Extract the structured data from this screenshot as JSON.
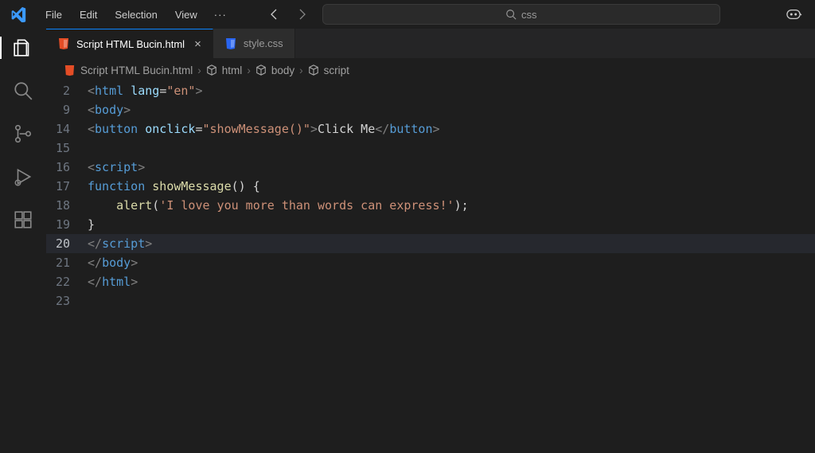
{
  "menu": {
    "file": "File",
    "edit": "Edit",
    "selection": "Selection",
    "view": "View",
    "more": "···"
  },
  "search": {
    "placeholder": "css"
  },
  "tabs": [
    {
      "label": "Script HTML Bucin.html",
      "icon": "html",
      "active": true,
      "dirty": false
    },
    {
      "label": "style.css",
      "icon": "css",
      "active": false,
      "dirty": false
    }
  ],
  "breadcrumbs": {
    "file": "Script HTML Bucin.html",
    "path": [
      "html",
      "body",
      "script"
    ]
  },
  "lineNumbers": [
    "2",
    "9",
    "14",
    "15",
    "16",
    "17",
    "18",
    "19",
    "20",
    "21",
    "22",
    "23"
  ],
  "currentLineIndex": 8,
  "code": {
    "l0": {
      "tag_html": "html",
      "attr_lang": "lang",
      "val_lang": "\"en\""
    },
    "l1": {
      "tag_body": "body"
    },
    "l2": {
      "tag_button": "button",
      "attr_onclick": "onclick",
      "val_onclick": "\"showMessage()\"",
      "text": "Click Me"
    },
    "l4": {
      "tag_script": "script"
    },
    "l5": {
      "kw_function": "function",
      "fn_name": "showMessage"
    },
    "l6": {
      "fn_alert": "alert",
      "str": "'I love you more than words can express!'"
    },
    "l8": {
      "tag_script": "script"
    },
    "l9": {
      "tag_body": "body"
    },
    "l10": {
      "tag_html": "html"
    }
  }
}
